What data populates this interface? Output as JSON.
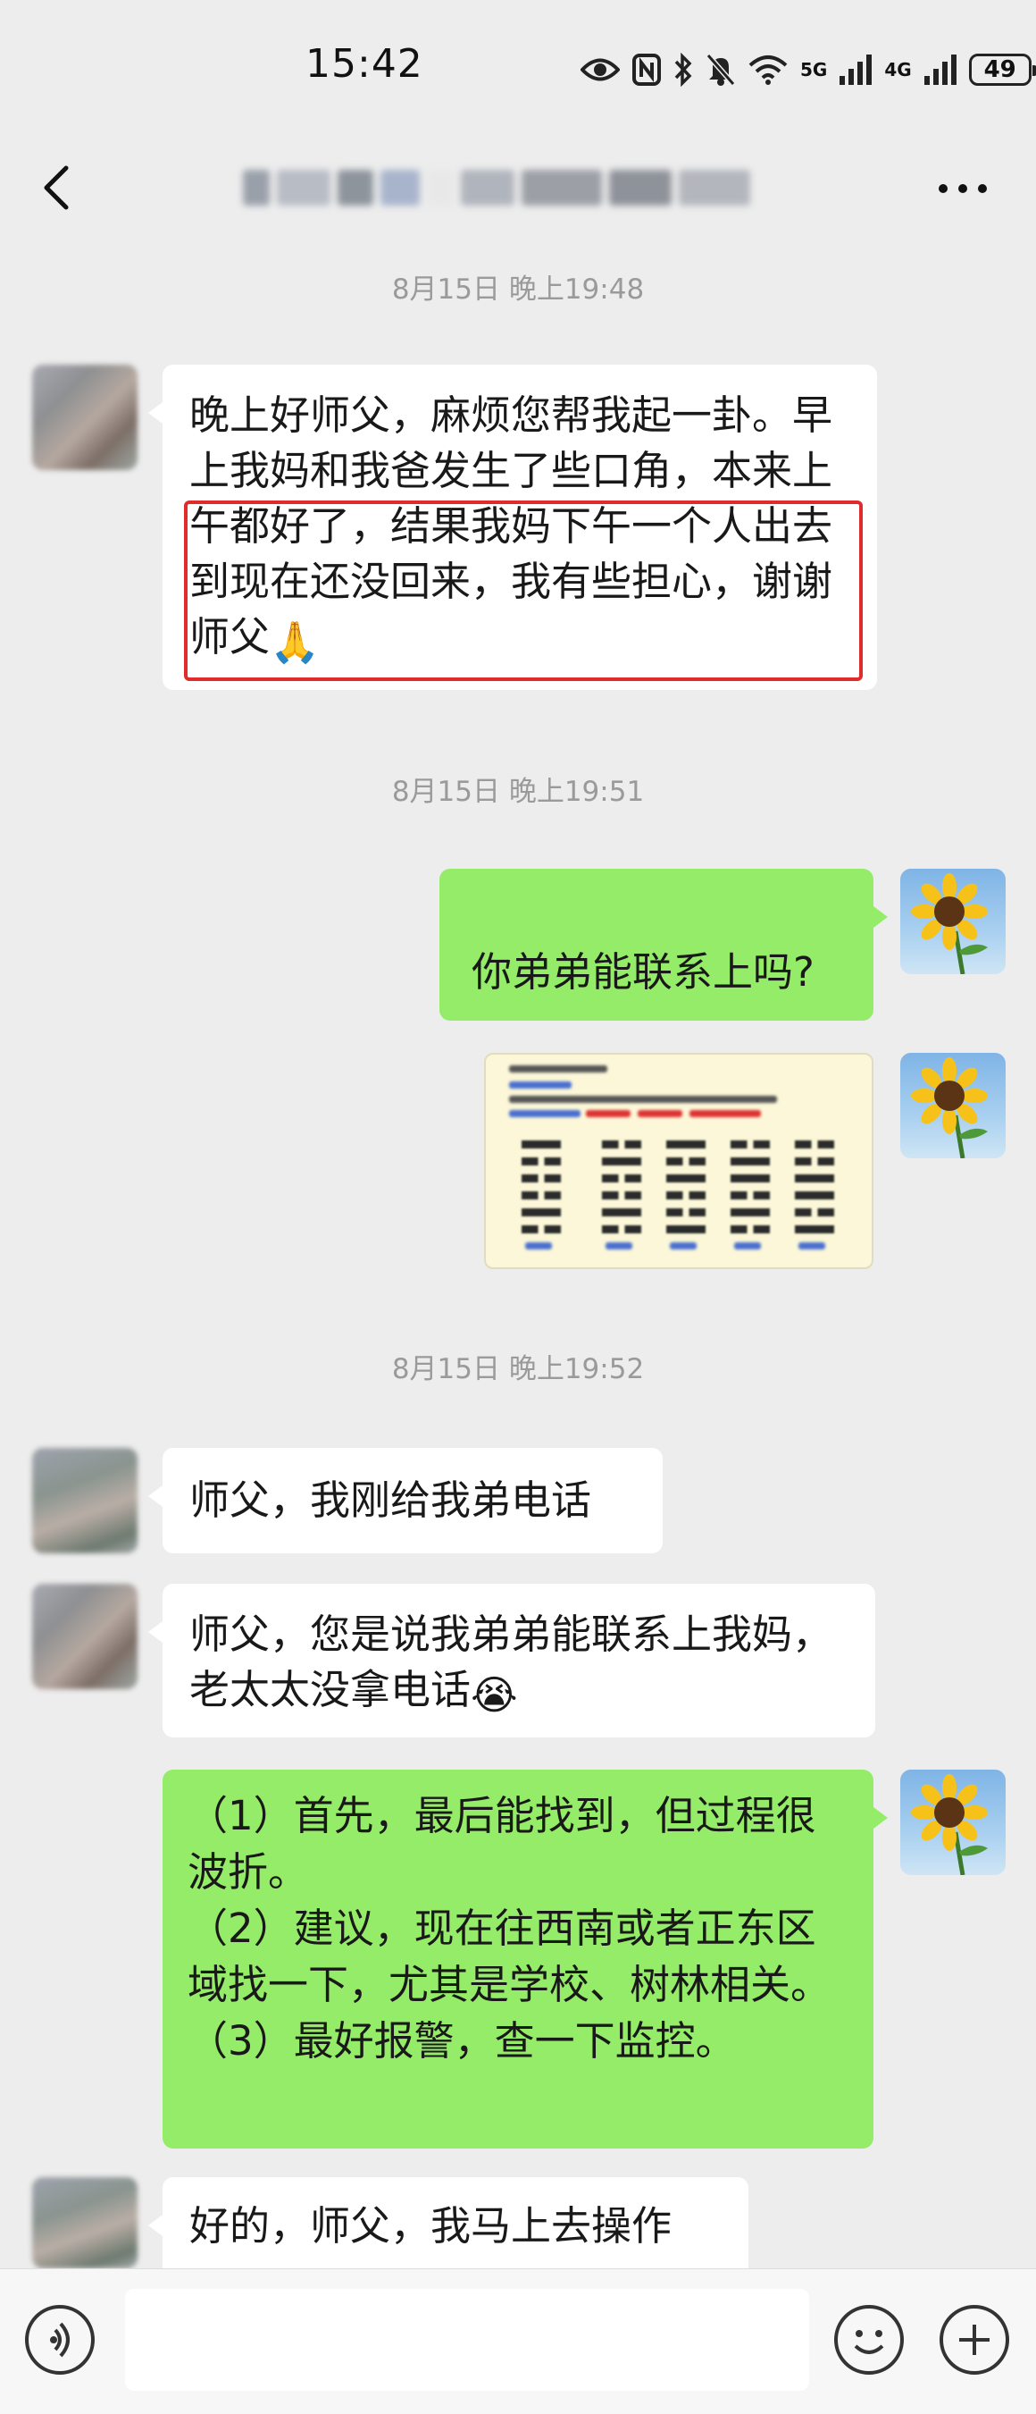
{
  "status_bar": {
    "time": "15:42",
    "battery": "49",
    "net1": "5G",
    "net2": "4G"
  },
  "nav": {
    "title": ""
  },
  "messages": [
    {
      "timestamp": "8月15日 晚上19:48"
    },
    {
      "from": "contact",
      "text": "晚上好师父，麻烦您帮我起一卦。早上我妈和我爸发生了些口角，本来上午都好了，结果我妈下午一个人出去到现在还没回来，我有些担心，谢谢师父",
      "emoji": "🙏"
    },
    {
      "timestamp": "8月15日 晚上19:51"
    },
    {
      "from": "me",
      "text": "你弟弟能联系上吗?"
    },
    {
      "from": "me",
      "type": "image"
    },
    {
      "timestamp": "8月15日 晚上19:52"
    },
    {
      "from": "contact",
      "text": "师父，我刚给我弟电话"
    },
    {
      "from": "contact",
      "text": "师父，您是说我弟弟能联系上我妈，老太太没拿电话",
      "emoji": "😭"
    },
    {
      "from": "me",
      "lines": [
        "（1）首先，最后能找到，但过程很波折。",
        "（2）建议，现在往西南或者正东区域找一下，尤其是学校、树林相关。",
        "（3）最好报警，查一下监控。"
      ]
    },
    {
      "from": "contact",
      "text": "好的，师父，我马上去操作"
    }
  ],
  "colors": {
    "bubble_out": "#95ec69",
    "bubble_in": "#ffffff",
    "background": "#ededed",
    "highlight": "#e02b2b"
  },
  "icons": [
    "back-arrow-icon",
    "more-icon",
    "voice-icon",
    "emoji-icon",
    "plus-icon",
    "eye-icon",
    "nfc-icon",
    "bluetooth-icon",
    "mute-icon",
    "wifi-icon",
    "signal-icon",
    "battery-icon"
  ]
}
